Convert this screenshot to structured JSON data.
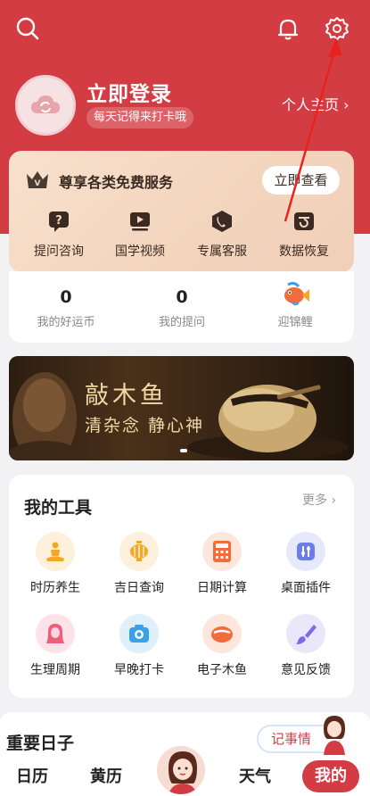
{
  "header": {
    "login_title": "立即登录",
    "login_subtitle": "每天记得来打卡哦",
    "profile_link": "个人主页 ›"
  },
  "services": {
    "title": "尊享各类免费服务",
    "view_button": "立即查看",
    "items": [
      {
        "label": "提问咨询",
        "icon": "question-bubble-icon"
      },
      {
        "label": "国学视频",
        "icon": "video-play-icon"
      },
      {
        "label": "专属客服",
        "icon": "phone-icon"
      },
      {
        "label": "数据恢复",
        "icon": "data-restore-icon"
      }
    ]
  },
  "stats": {
    "coins_value": "0",
    "coins_label": "我的好运币",
    "questions_value": "0",
    "questions_label": "我的提问",
    "koi_label": "迎锦鲤"
  },
  "banner": {
    "title": "敲木鱼",
    "subtitle": "清杂念 静心神"
  },
  "tools": {
    "title": "我的工具",
    "more": "更多 ›",
    "items": [
      {
        "label": "时历养生",
        "icon": "meditation-icon",
        "color": "#f5a623"
      },
      {
        "label": "吉日查询",
        "icon": "lantern-icon",
        "color": "#f5a623"
      },
      {
        "label": "日期计算",
        "icon": "calculator-icon",
        "color": "#f26b3a"
      },
      {
        "label": "桌面插件",
        "icon": "widget-icon",
        "color": "#6b7de8"
      },
      {
        "label": "生理周期",
        "icon": "woman-icon",
        "color": "#e8607a"
      },
      {
        "label": "早晚打卡",
        "icon": "camera-icon",
        "color": "#3aa0e8"
      },
      {
        "label": "电子木鱼",
        "icon": "wooden-fish-icon",
        "color": "#f26b3a"
      },
      {
        "label": "意见反馈",
        "icon": "brush-icon",
        "color": "#7b6be8"
      }
    ]
  },
  "important": {
    "title": "重要日子",
    "note_button": "记事情"
  },
  "tabbar": {
    "calendar": "日历",
    "almanac": "黄历",
    "weather": "天气",
    "mine": "我的"
  },
  "colors": {
    "brand_red": "#d43c43"
  }
}
